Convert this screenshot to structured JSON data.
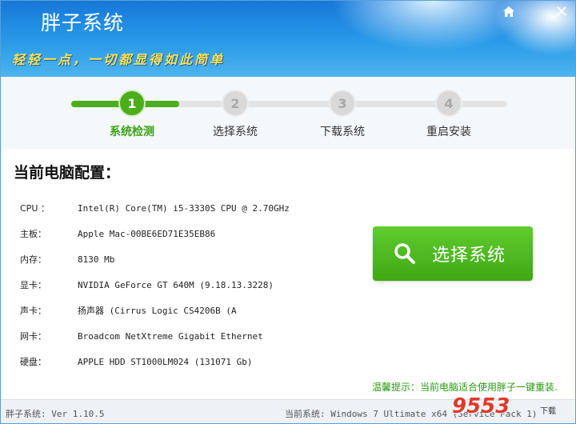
{
  "header": {
    "app_title": "胖子系统",
    "slogan": "轻轻一点，一切都显得如此简单"
  },
  "steps": [
    {
      "number": "1",
      "label": "系统检测",
      "active": true
    },
    {
      "number": "2",
      "label": "选择系统",
      "active": false
    },
    {
      "number": "3",
      "label": "下载系统",
      "active": false
    },
    {
      "number": "4",
      "label": "重启安装",
      "active": false
    }
  ],
  "config": {
    "title": "当前电脑配置：",
    "rows": [
      {
        "key": "CPU ：",
        "value": "Intel(R) Core(TM) i5-3330S CPU @ 2.70GHz"
      },
      {
        "key": "主板：",
        "value": "Apple Mac-00BE6ED71E35EB86"
      },
      {
        "key": "内存：",
        "value": "8130 Mb"
      },
      {
        "key": "显卡：",
        "value": "NVIDIA GeForce GT 640M (9.18.13.3228)"
      },
      {
        "key": "声卡：",
        "value": "扬声器 (Cirrus Logic CS4206B (A"
      },
      {
        "key": "网卡：",
        "value": "Broadcom NetXtreme Gigabit Ethernet"
      },
      {
        "key": "硬盘：",
        "value": "APPLE HDD ST1000LM024 (131071 Gb)"
      }
    ]
  },
  "select_button": {
    "label": "选择系统",
    "icon": "search-icon"
  },
  "tip": "温馨提示：当前电脑适合使用胖子一键重装.",
  "status": {
    "version": "胖子系统: Ver 1.10.5",
    "current_system": "当前系统: Windows 7 Ultimate x64 (Service Pack 1)"
  },
  "watermark": {
    "logo": "9553",
    "suffix": "下载"
  },
  "colors": {
    "accent_green": "#4cae1a",
    "header_blue": "#1677d9",
    "tip_green": "#2a9a10"
  }
}
